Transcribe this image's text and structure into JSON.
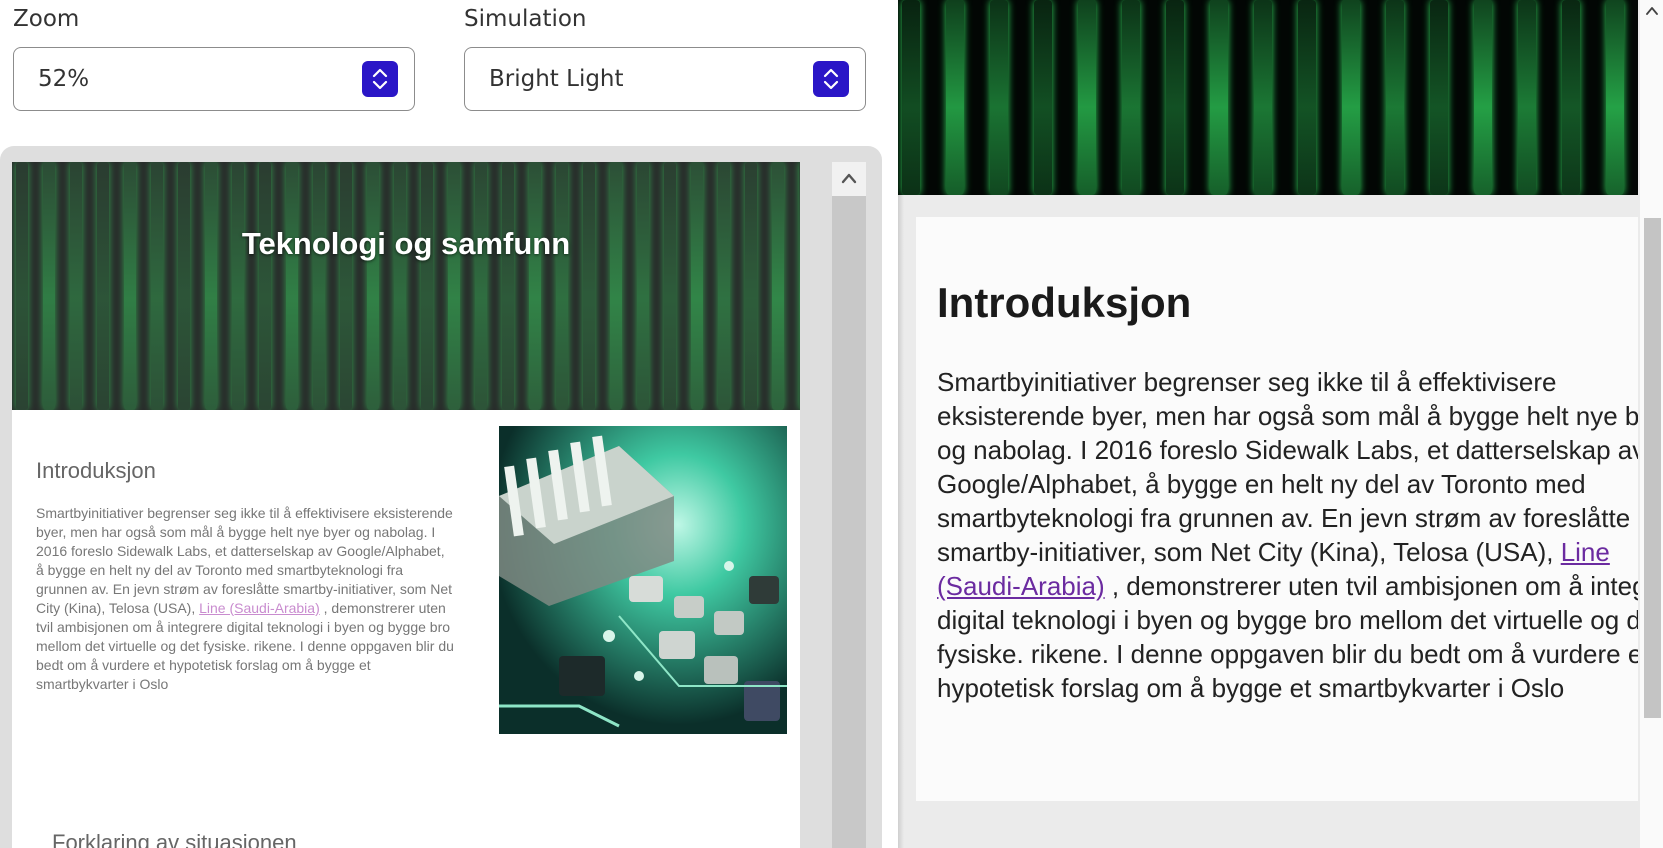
{
  "controls": {
    "zoom": {
      "label": "Zoom",
      "value": "52%"
    },
    "simulation": {
      "label": "Simulation",
      "value": "Bright Light"
    }
  },
  "preview": {
    "hero_title": "Teknologi og samfunn",
    "section_heading": "Introduksjon",
    "paragraph_before_link": "Smartbyinitiativer begrenser seg ikke til å effektivisere eksisterende byer, men har også som mål å bygge helt nye byer og nabolag. I 2016 foreslo Sidewalk Labs, et datterselskap av Google/Alphabet, å bygge en helt ny del av Toronto med smartbyteknologi fra grunnen av. En jevn strøm av foreslåtte smartby-initiativer, som Net City (Kina), Telosa (USA), ",
    "link_text": "Line (Saudi-Arabia)",
    "paragraph_after_link": " , demonstrerer uten tvil ambisjonen om å integrere digital teknologi i byen og bygge bro mellom det virtuelle og det fysiske. rikene. I denne oppgaven blir du bedt om å vurdere et hypotetisk forslag om å bygge et smartbykvarter i Oslo",
    "next_heading": "Forklaring av situasjonen"
  },
  "magnifier": {
    "section_heading": "Introduksjon",
    "paragraph_before_link": "Smartbyinitiativer begrenser seg ikke til å effektivisere eksisterende byer, men har også som mål å bygge helt nye byer og nabolag. I 2016 foreslo Sidewalk Labs, et datterselskap av Google/Alphabet, å bygge en helt ny del av Toronto med smartbyteknologi fra grunnen av. En jevn strøm av foreslåtte smartby-initiativer, som Net City (Kina), Telosa (USA), ",
    "link_text": "Line (Saudi-Arabia)",
    "paragraph_after_link": " , demonstrerer uten tvil ambisjonen om å integrere digital teknologi i byen og bygge bro mellom det virtuelle og det fysiske. rikene. I denne oppgaven blir du bedt om å vurdere et hypotetisk forslag om å bygge et smartbykvarter i Oslo"
  },
  "colors": {
    "stepper": "#2a16c7",
    "preview_link": "#c98ccf",
    "magnifier_link": "#6b2ba0",
    "matrix_green": "#2fd05a"
  },
  "icons": {
    "stepper": "up-down-chevron-icon",
    "scroll_up": "chevron-up-icon"
  }
}
